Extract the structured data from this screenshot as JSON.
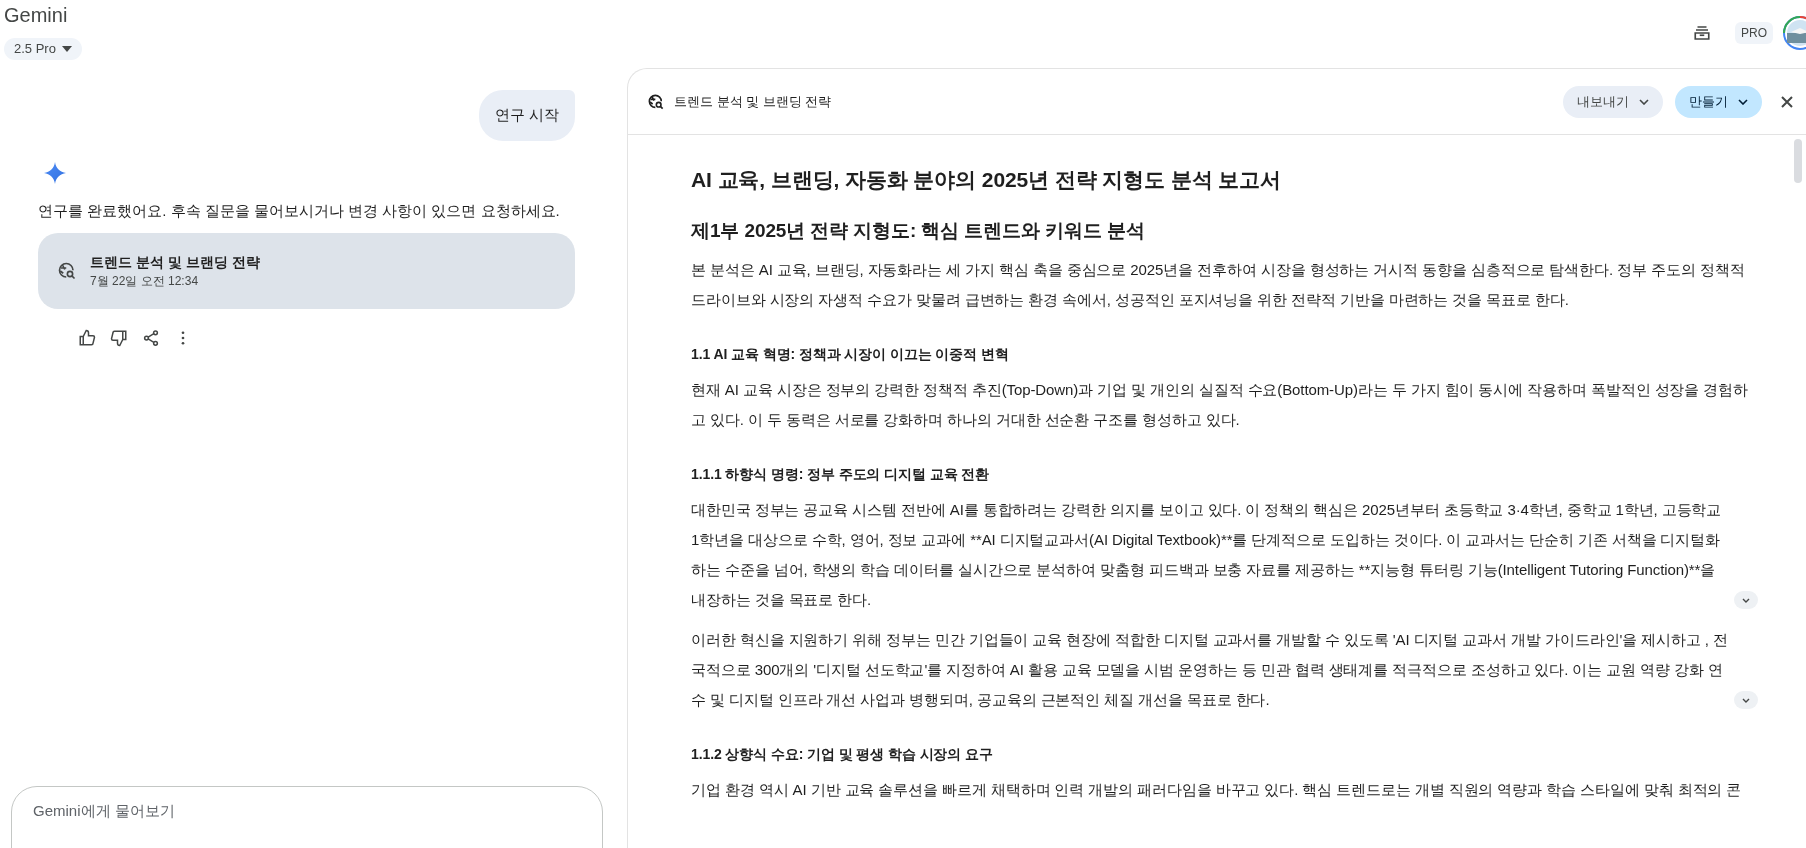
{
  "app": {
    "title": "Gemini",
    "model": "2.5 Pro",
    "badge": "PRO"
  },
  "chat": {
    "user_message": "연구 시작",
    "response": "연구를 완료했어요. 후속 질문을 물어보시거나 변경 사항이 있으면 요청하세요.",
    "card": {
      "title": "트렌드 분석 및 브랜딩 전략",
      "timestamp": "7월 22일 오전 12:34"
    },
    "input": {
      "placeholder": "Gemini에게 물어보기"
    }
  },
  "panel": {
    "title": "트렌드 분석 및 브랜딩 전략",
    "buttons": [
      {
        "label": "내보내기",
        "kind": "secondary"
      },
      {
        "label": "만들기",
        "kind": "primary"
      }
    ],
    "document": [
      {
        "kind": "h1",
        "text": "AI 교육, 브랜딩, 자동화 분야의 2025년 전략 지형도 분석 보고서"
      },
      {
        "kind": "h2",
        "text": "제1부 2025년 전략 지형도: 핵심 트렌드와 키워드 분석"
      },
      {
        "kind": "p",
        "text": "본 분석은 AI 교육, 브랜딩, 자동화라는 세 가지 핵심 축을 중심으로 2025년을 전후하여 시장을 형성하는 거시적 동향을 심층적으로 탐색한다. 정부 주도의 정책적 드라이브와 시장의 자생적 수요가 맞물려 급변하는 환경 속에서, 성공적인 포지셔닝을 위한 전략적 기반을 마련하는 것을 목표로 한다.",
        "expand": false
      },
      {
        "kind": "h3",
        "text": "1.1 AI 교육 혁명: 정책과 시장이 이끄는 이중적 변혁"
      },
      {
        "kind": "p",
        "text": "현재 AI 교육 시장은 정부의 강력한 정책적 추진(Top-Down)과 기업 및 개인의 실질적 수요(Bottom-Up)라는 두 가지 힘이 동시에 작용하며 폭발적인 성장을 경험하고 있다. 이 두 동력은 서로를 강화하며 하나의 거대한 선순환 구조를 형성하고 있다.",
        "expand": false
      },
      {
        "kind": "h3",
        "text": "1.1.1 하향식 명령: 정부 주도의 디지털 교육 전환"
      },
      {
        "kind": "p",
        "text": "대한민국 정부는 공교육 시스템 전반에 AI를 통합하려는 강력한 의지를 보이고 있다. 이 정책의 핵심은 2025년부터 초등학교 3·4학년, 중학교 1학년, 고등학교 1학년을 대상으로 수학, 영어, 정보 교과에 **AI 디지털교과서(AI Digital Textbook)**를 단계적으로 도입하는 것이다. 이 교과서는 단순히 기존 서책을 디지털화하는 수준을 넘어, 학생의 학습 데이터를 실시간으로 분석하여 맞춤형 피드백과 보충 자료를 제공하는 **지능형 튜터링 기능(Intelligent Tutoring Function)**을 내장하는 것을 목표로 한다.",
        "expand": true
      },
      {
        "kind": "p",
        "text": "이러한 혁신을 지원하기 위해 정부는 민간 기업들이 교육 현장에 적합한 디지털 교과서를 개발할 수 있도록 'AI 디지털 교과서 개발 가이드라인'을 제시하고 , 전국적으로 300개의 '디지털 선도학교'를 지정하여 AI 활용 교육 모델을 시범 운영하는 등 민관 협력 생태계를 적극적으로 조성하고 있다. 이는 교원 역량 강화 연수 및 디지털 인프라 개선 사업과 병행되며, 공교육의 근본적인 체질 개선을 목표로 한다.",
        "expand": true
      },
      {
        "kind": "h3",
        "text": "1.1.2 상향식 수요: 기업 및 평생 학습 시장의 요구"
      },
      {
        "kind": "p",
        "text": "기업 환경 역시 AI 기반 교육 솔루션을 빠르게 채택하며 인력 개발의 패러다임을 바꾸고 있다. 핵심 트렌드로는 개별 직원의 역량과 학습 스타일에 맞춰 최적의 콘",
        "expand": false
      }
    ]
  }
}
